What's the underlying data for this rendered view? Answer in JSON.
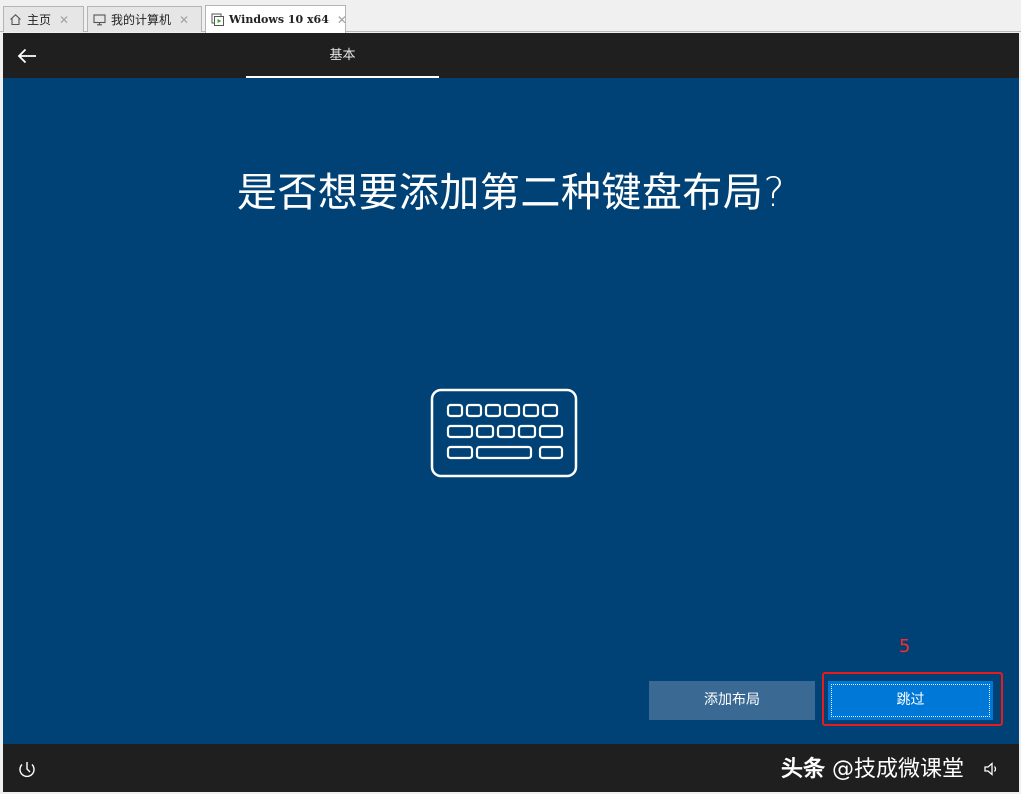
{
  "tabs": [
    {
      "label": "主页",
      "icon": "home-icon"
    },
    {
      "label": "我的计算机",
      "icon": "computer-icon"
    },
    {
      "label": "Windows 10 x64",
      "icon": "vm-icon",
      "active": true
    }
  ],
  "topbar": {
    "back_icon": "arrow-left-icon",
    "step_label": "基本"
  },
  "main": {
    "question": "是否想要添加第二种键盘布局?",
    "illustration_icon": "keyboard-icon",
    "annotation_number": "5",
    "add_layout_label": "添加布局",
    "skip_label": "跳过"
  },
  "bottombar": {
    "accessibility_icon": "ease-of-access-icon",
    "watermark_prefix": "头条",
    "watermark_handle": "@技成微课堂",
    "volume_icon": "volume-icon"
  },
  "colors": {
    "screen_bg": "#004275",
    "bar_bg": "#1f1f1f",
    "primary_button": "#0078d7",
    "secondary_button": "#3a6994",
    "annotation_red": "#e61c1c"
  }
}
